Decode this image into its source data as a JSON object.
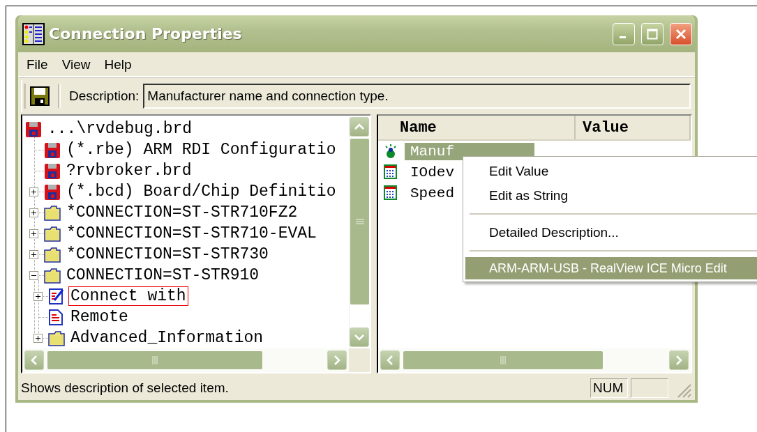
{
  "window": {
    "title": "Connection Properties"
  },
  "menu_bar": [
    "File",
    "View",
    "Help"
  ],
  "toolbar": {
    "description_label": "Description:",
    "description_value": "Manufacturer name and connection type."
  },
  "tree": [
    {
      "label": "...\\rvdebug.brd",
      "kind": "disk",
      "outlined": false,
      "children": [
        {
          "label": "(*.rbe) ARM RDI Configuratio",
          "kind": "disk",
          "outlined": false
        },
        {
          "label": "?rvbroker.brd",
          "kind": "disk",
          "outlined": false
        },
        {
          "label": "(*.bcd) Board/Chip Definitio",
          "kind": "disk",
          "expanded": false,
          "outlined": false
        },
        {
          "label": "*CONNECTION=ST-STR710FZ2",
          "kind": "folder",
          "expanded": false,
          "outlined": false
        },
        {
          "label": "*CONNECTION=ST-STR710-EVAL",
          "kind": "folder",
          "expanded": false,
          "outlined": false
        },
        {
          "label": "*CONNECTION=ST-STR730",
          "kind": "folder",
          "expanded": false,
          "outlined": false
        },
        {
          "label": "CONNECTION=ST-STR910",
          "kind": "folder",
          "expanded": true,
          "outlined": false,
          "children": [
            {
              "label": "Connect with",
              "kind": "edit",
              "expanded": false,
              "outlined": true
            },
            {
              "label": "Remote",
              "kind": "document",
              "outlined": false
            },
            {
              "label": "Advanced_Information",
              "kind": "folder",
              "expanded": false,
              "outlined": false
            }
          ]
        }
      ]
    }
  ],
  "properties": {
    "columns": [
      "Name",
      "Value"
    ],
    "rows": [
      {
        "name": "Manuf",
        "kind": "node",
        "selected": true
      },
      {
        "name": "IOdev",
        "kind": "table",
        "selected": false
      },
      {
        "name": "Speed",
        "kind": "table",
        "selected": false
      }
    ]
  },
  "context_menu": [
    {
      "kind": "item",
      "label": "Edit Value",
      "selected": false
    },
    {
      "kind": "item",
      "label": "Edit as String",
      "selected": false
    },
    {
      "kind": "separator"
    },
    {
      "kind": "item",
      "label": "Detailed Description...",
      "selected": false
    },
    {
      "kind": "separator"
    },
    {
      "kind": "item",
      "label": "ARM-ARM-USB - RealView ICE Micro Edit",
      "selected": true
    }
  ],
  "status_bar": {
    "text": "Shows description of selected item.",
    "panels": [
      "NUM"
    ]
  }
}
